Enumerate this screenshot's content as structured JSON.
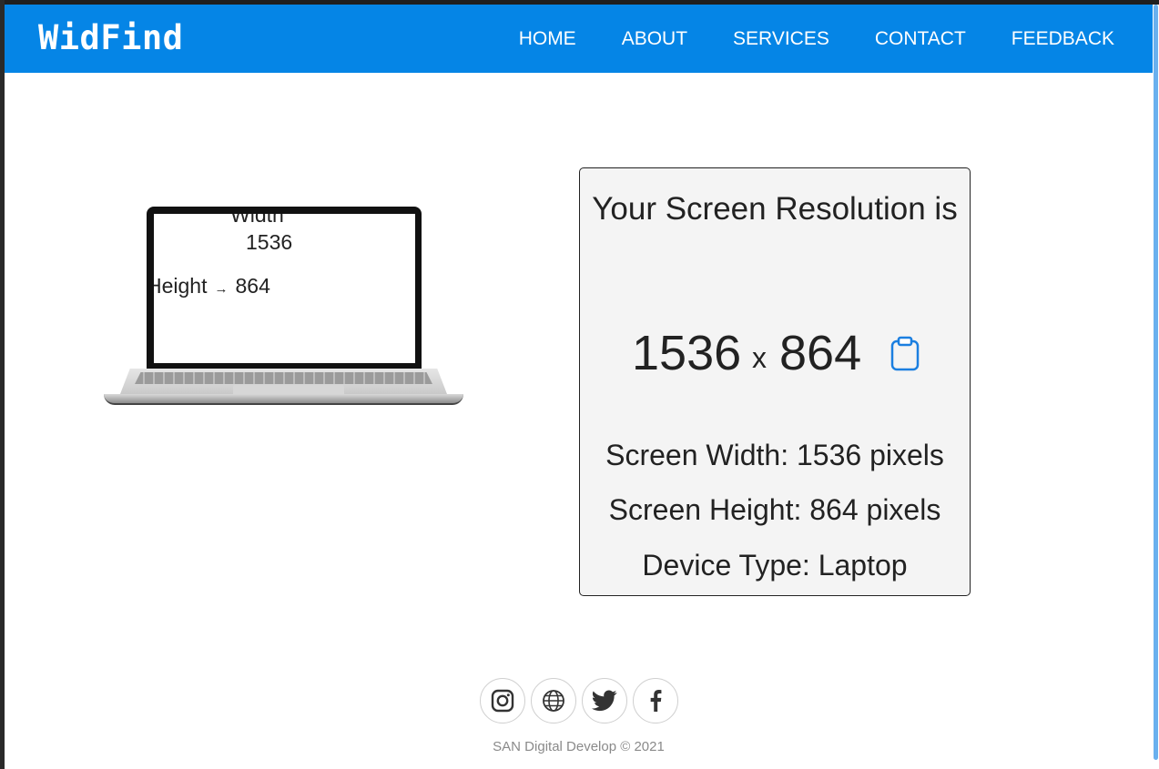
{
  "nav": {
    "brand": "WidFind",
    "links": [
      "HOME",
      "ABOUT",
      "SERVICES",
      "CONTACT",
      "FEEDBACK"
    ]
  },
  "illustration": {
    "width_label": "Width",
    "width_value": "1536",
    "height_label": "Height",
    "arrow": "→",
    "height_value": "864"
  },
  "card": {
    "title": "Your Screen Resolution is",
    "width": "1536",
    "separator": "x",
    "height": "864",
    "copy_icon": "clipboard-icon",
    "screen_width_line": "Screen Width: 1536 pixels",
    "screen_height_line": "Screen Height: 864 pixels",
    "device_type_line": "Device Type: Laptop"
  },
  "footer": {
    "social_icons": [
      "instagram-icon",
      "globe-icon",
      "twitter-icon",
      "facebook-icon"
    ],
    "copyright": "SAN Digital Develop © 2021"
  },
  "colors": {
    "nav_bg": "#0585e6",
    "card_bg": "#f4f4f4",
    "accent_icon": "#1b7fe0"
  }
}
